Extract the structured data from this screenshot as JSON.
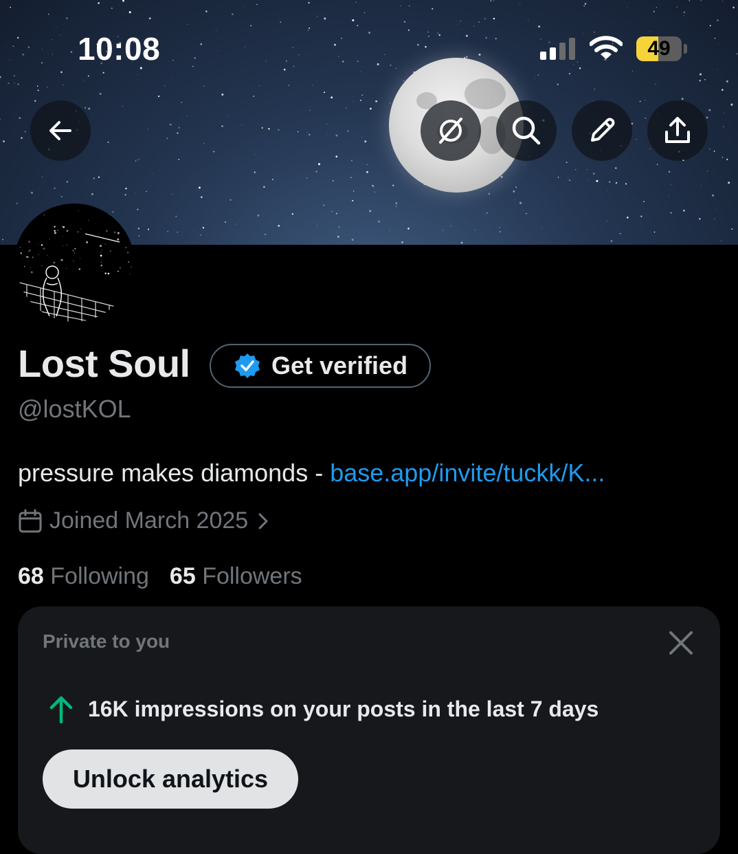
{
  "status_bar": {
    "time": "10:08",
    "battery_percent": "49"
  },
  "banner": {
    "description_icon": "moon-night-sky"
  },
  "toolbar": {
    "back_icon": "arrow-left-icon",
    "grok_icon": "grok-icon",
    "search_icon": "search-icon",
    "edit_icon": "pencil-icon",
    "share_icon": "share-icon"
  },
  "profile": {
    "name": "Lost Soul",
    "verify_label": "Get verified",
    "handle": "@lostKOL",
    "bio_text": "pressure makes diamonds - ",
    "bio_link": "base.app/invite/tuckk/K...",
    "joined": "Joined March 2025",
    "following_count": "68",
    "following_label": "Following",
    "followers_count": "65",
    "followers_label": "Followers"
  },
  "private_card": {
    "title": "Private to you",
    "impressions_text": "16K impressions on your posts in the last 7 days",
    "button_label": "Unlock analytics"
  },
  "colors": {
    "accent": "#1d9bf0",
    "verified_badge": "#1d9bf0",
    "impressions_arrow": "#00ba7c",
    "battery": "#f5d33a"
  }
}
